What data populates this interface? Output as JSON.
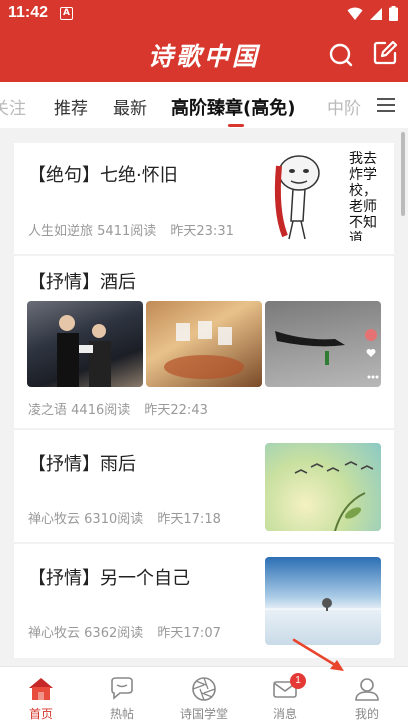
{
  "status_bar": {
    "time": "11:42",
    "sim_label": "A"
  },
  "header": {
    "app_title": "诗歌中国"
  },
  "tabs": [
    {
      "label": "关注"
    },
    {
      "label": "推荐"
    },
    {
      "label": "最新"
    },
    {
      "label": "高阶臻章(高免)"
    },
    {
      "label": "中阶"
    }
  ],
  "active_tab": "高阶臻章(高免)",
  "articles": [
    {
      "title": "【绝句】七绝·怀旧",
      "author": "人生如逆旅",
      "reads": "5411阅读",
      "time": "昨天23:31",
      "thumb_text": "我去炸学校，老师不知道"
    },
    {
      "title": "【抒情】酒后",
      "author": "凌之语",
      "reads": "4416阅读",
      "time": "昨天22:43"
    },
    {
      "title": "【抒情】雨后",
      "author": "禅心牧云",
      "reads": "6310阅读",
      "time": "昨天17:18"
    },
    {
      "title": "【抒情】另一个自己",
      "author": "禅心牧云",
      "reads": "6362阅读",
      "time": "昨天17:07"
    }
  ],
  "bottom_nav": [
    {
      "label": "首页",
      "icon": "home-icon",
      "active": true
    },
    {
      "label": "热帖",
      "icon": "chat-bubble-icon"
    },
    {
      "label": "诗国学堂",
      "icon": "aperture-icon"
    },
    {
      "label": "消息",
      "icon": "mail-icon",
      "badge": "1"
    },
    {
      "label": "我的",
      "icon": "person-icon"
    }
  ],
  "colors": {
    "brand": "#d7372c",
    "badge": "#e53935",
    "annotation_arrow": "#e8452c"
  }
}
